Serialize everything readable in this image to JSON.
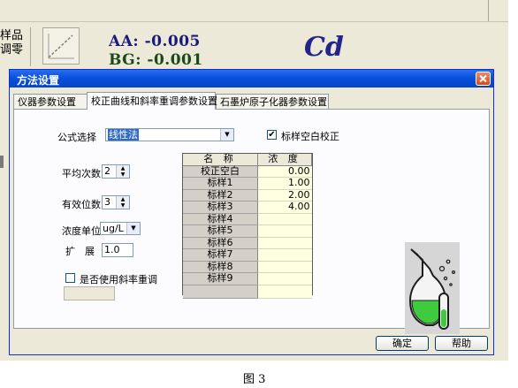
{
  "background_app": {
    "sample_label_line1": "样品",
    "sample_label_line2": "调零",
    "aa_readout": "AA: -0.005",
    "bg_readout": "BG: -0.001",
    "element_symbol": "Cd"
  },
  "dialog": {
    "title": "方法设置",
    "tabs": [
      {
        "label": "仪器参数设置",
        "active": false
      },
      {
        "label": "校正曲线和斜率重调参数设置",
        "active": true
      },
      {
        "label": "石墨炉原子化器参数设置",
        "active": false
      }
    ],
    "formula": {
      "label": "公式选择",
      "value": "线性法"
    },
    "blank_correction": {
      "label": "标样空白校正",
      "checked": true
    },
    "average_count": {
      "label": "平均次数",
      "value": "2"
    },
    "significant_digits": {
      "label": "有效位数",
      "value": "3"
    },
    "concentration_unit": {
      "label": "浓度单位",
      "value": "ug/L"
    },
    "expand": {
      "label": "扩　展",
      "value": "1.0"
    },
    "slope_recalibration": {
      "label": "是否使用斜率重调",
      "checked": false,
      "value": ""
    },
    "standards_table": {
      "columns": [
        "名 称",
        "浓 度"
      ],
      "rows": [
        {
          "name": "校正空白",
          "conc": "0.00"
        },
        {
          "name": "标样1",
          "conc": "1.00"
        },
        {
          "name": "标样2",
          "conc": "2.00"
        },
        {
          "name": "标样3",
          "conc": "4.00"
        },
        {
          "name": "标样4",
          "conc": ""
        },
        {
          "name": "标样5",
          "conc": ""
        },
        {
          "name": "标样6",
          "conc": ""
        },
        {
          "name": "标样7",
          "conc": ""
        },
        {
          "name": "标样8",
          "conc": ""
        },
        {
          "name": "标样9",
          "conc": ""
        }
      ]
    },
    "ok_label": "确定",
    "help_label": "帮助"
  },
  "caption": "图 3",
  "colors": {
    "titlebar": "#0a50dc",
    "dialog_face": "#ece9d8",
    "concentration_cell": "#ffffe1",
    "flask_liquid": "#3ecb3e"
  }
}
